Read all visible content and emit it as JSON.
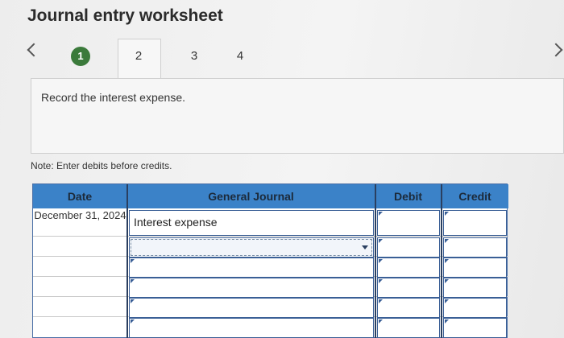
{
  "title": "Journal entry worksheet",
  "tabs": [
    {
      "label": "1",
      "state": "done"
    },
    {
      "label": "2",
      "state": "active"
    },
    {
      "label": "3",
      "state": "normal"
    },
    {
      "label": "4",
      "state": "normal"
    }
  ],
  "instruction": "Record the interest expense.",
  "note": "Note: Enter debits before credits.",
  "journal": {
    "headers": {
      "date": "Date",
      "general_journal": "General Journal",
      "debit": "Debit",
      "credit": "Credit"
    },
    "first_date": "December 31, 2024",
    "first_account": "Interest expense",
    "header_color": "#3b82c8",
    "done_color": "#3b7a3b"
  }
}
